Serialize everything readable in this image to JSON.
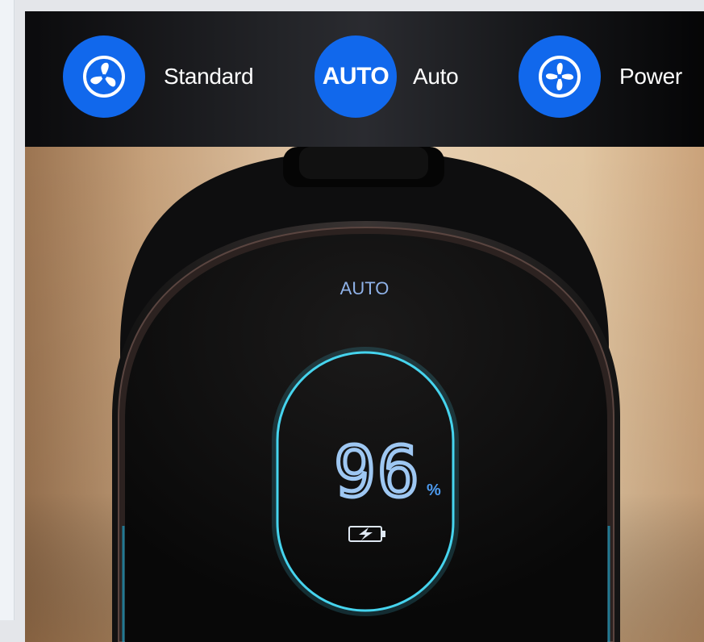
{
  "modes": [
    {
      "id": "standard",
      "label": "Standard",
      "icon": "fan-blades-icon"
    },
    {
      "id": "auto",
      "label": "Auto",
      "icon_text": "AUTO"
    },
    {
      "id": "power",
      "label": "Power",
      "icon": "fan-power-icon"
    }
  ],
  "device_display": {
    "mode_text": "AUTO",
    "battery_percent": "96",
    "percent_symbol": "%",
    "charging_icon": "battery-charging-icon"
  },
  "colors": {
    "accent_blue": "#1168ec",
    "ring_cyan": "#46d4ee",
    "digit_blue": "#9ec7f2",
    "body_black": "#0b0b0c"
  }
}
